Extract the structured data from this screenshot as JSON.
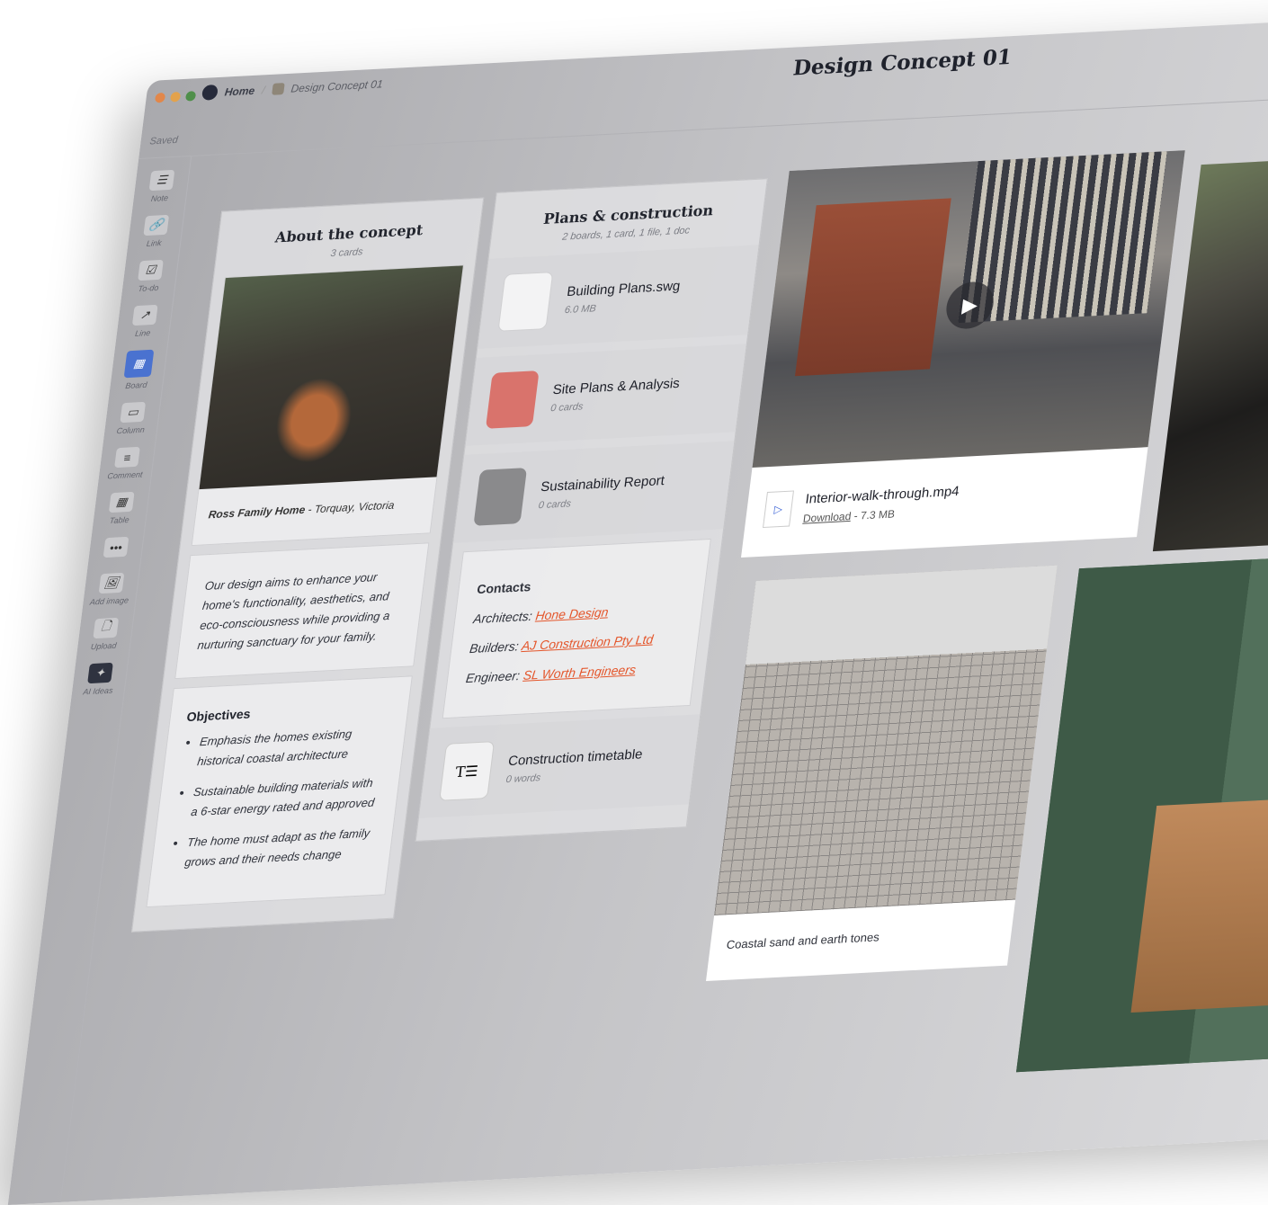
{
  "window": {
    "title": "Design Concept 01",
    "status": "Saved",
    "traffic_lights": [
      "#e2874a",
      "#e3a24c",
      "#4f8f4a"
    ]
  },
  "breadcrumb": {
    "home": "Home",
    "current": "Design Concept 01"
  },
  "sidebar": {
    "items": [
      {
        "label": "Note",
        "icon": "note-icon",
        "glyph": "☰"
      },
      {
        "label": "Link",
        "icon": "link-icon",
        "glyph": "🔗"
      },
      {
        "label": "To-do",
        "icon": "todo-icon",
        "glyph": "☑"
      },
      {
        "label": "Line",
        "icon": "line-icon",
        "glyph": "↗"
      },
      {
        "label": "Board",
        "icon": "board-icon",
        "glyph": "▦"
      },
      {
        "label": "Column",
        "icon": "column-icon",
        "glyph": "▭"
      },
      {
        "label": "Comment",
        "icon": "comment-icon",
        "glyph": "≡"
      },
      {
        "label": "Table",
        "icon": "table-icon",
        "glyph": "▦"
      },
      {
        "label": "",
        "icon": "more-icon",
        "glyph": "•••"
      },
      {
        "label": "Add image",
        "icon": "image-icon",
        "glyph": "🖼"
      },
      {
        "label": "Upload",
        "icon": "upload-icon",
        "glyph": "🗋"
      },
      {
        "label": "AI Ideas",
        "icon": "ai-icon",
        "glyph": "✦"
      }
    ],
    "accent": "#4a72d0"
  },
  "about": {
    "title": "About the concept",
    "subtitle": "3 cards",
    "caption_bold": "Ross Family Home",
    "caption_rest": " - Torquay, Victoria",
    "note": "Our design aims to enhance your home's functionality, aesthetics, and eco-consciousness while providing a nurturing sanctuary for your family.",
    "objectives_title": "Objectives",
    "objectives": [
      "Emphasis the homes existing historical coastal architecture",
      "Sustainable building materials with a 6-star energy rated and approved",
      "The home must adapt as the family grows and their needs change"
    ]
  },
  "plans": {
    "title": "Plans & construction",
    "subtitle": "2 boards, 1 card, 1 file, 1 doc",
    "items": [
      {
        "title": "Building Plans.swg",
        "meta": "6.0 MB",
        "icon": "file-icon"
      },
      {
        "title": "Site Plans & Analysis",
        "meta": "0 cards",
        "icon": "board-icon",
        "color": "#d9736c"
      },
      {
        "title": "Sustainability Report",
        "meta": "0 cards",
        "icon": "leaf-icon",
        "color": "#8a8a8c"
      }
    ],
    "contacts_title": "Contacts",
    "contacts": [
      {
        "label": "Architects:",
        "link": "Hone Design"
      },
      {
        "label": "Builders:",
        "link": "AJ Construction Pty Ltd"
      },
      {
        "label": "Engineer:",
        "link": "SL Worth Engineers"
      }
    ],
    "doc_title": "Construction timetable",
    "doc_meta": "0 words",
    "link_color": "#e4552a"
  },
  "video": {
    "filename": "Interior-walk-through.mp4",
    "download": "Download",
    "size": " - 7.3 MB"
  },
  "bathroom": {
    "caption": "Coastal sand and earth tones"
  }
}
